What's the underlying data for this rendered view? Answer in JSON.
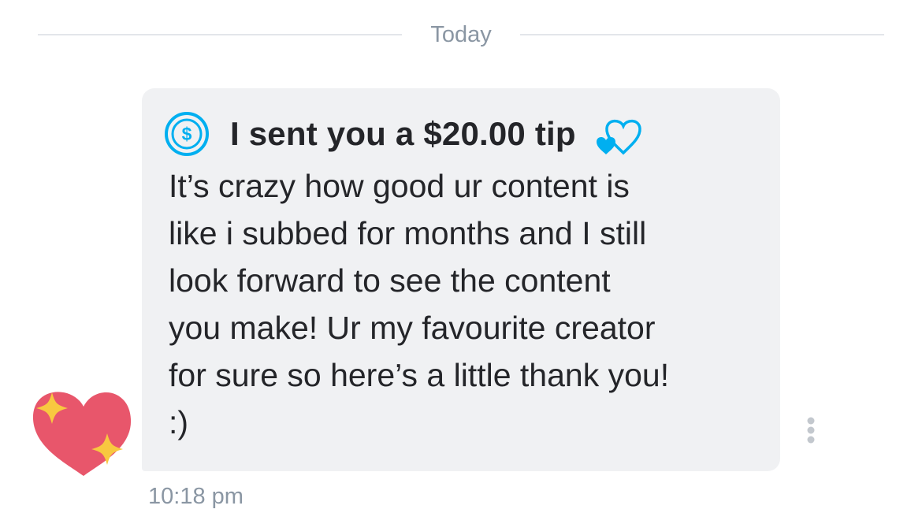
{
  "divider": {
    "label": "Today"
  },
  "message": {
    "tip_text": "I sent you a $20.00 tip",
    "body": "It’s crazy how good ur content is\nlike i subbed for months and I still\nlook forward to see the content\nyou make! Ur my favourite creator\nfor sure so here’s a little thank you!\n:)",
    "time": "10:18 pm"
  },
  "icons": {
    "tip": "dollar-circle-icon",
    "hearts": "two-hearts-icon",
    "avatar": "sparkling-heart-avatar",
    "more": "more-vertical-icon"
  },
  "colors": {
    "accent": "#00aff0",
    "bubble_bg": "#f0f1f3",
    "text": "#242529",
    "muted": "#8a96a3",
    "heart": "#e8566b",
    "sparkle": "#f8c840"
  }
}
